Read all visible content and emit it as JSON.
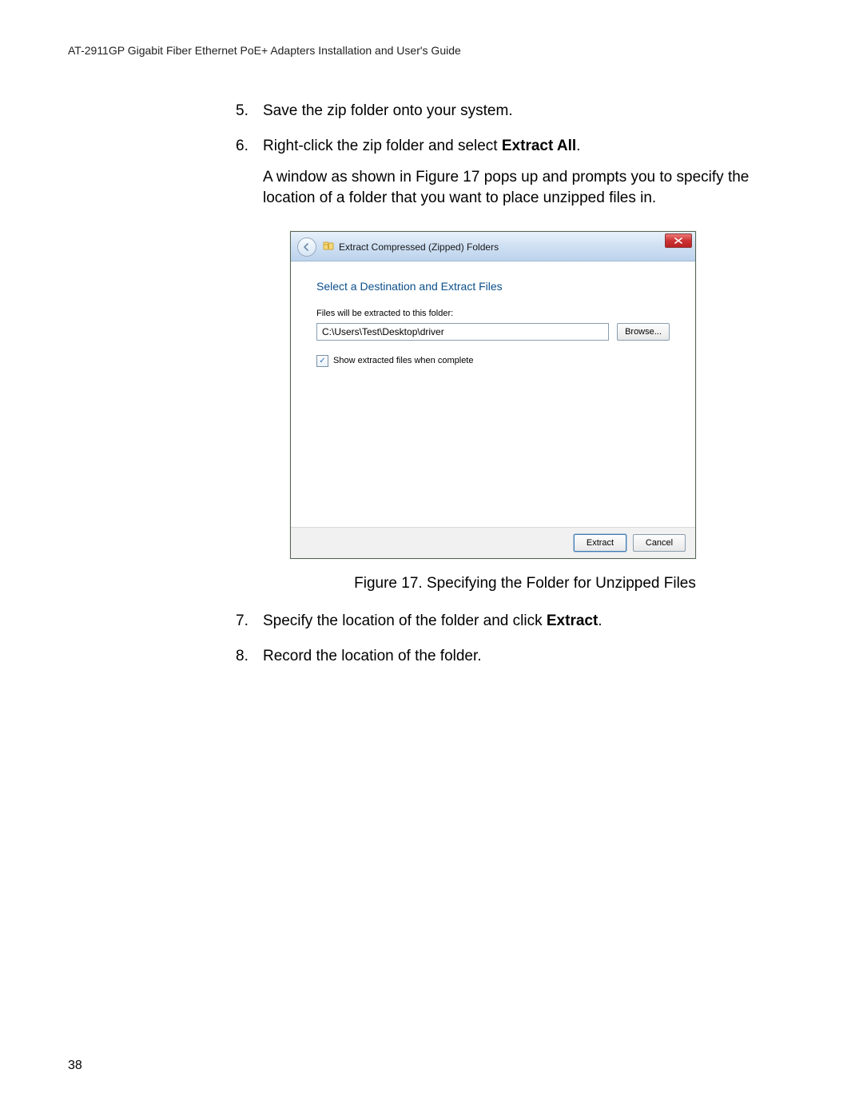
{
  "header": "AT-2911GP Gigabit Fiber Ethernet PoE+ Adapters Installation and User's Guide",
  "page_number": "38",
  "steps": {
    "s5": {
      "num": "5.",
      "text": "Save the zip folder onto your system."
    },
    "s6": {
      "num": "6.",
      "text_pre": "Right-click the zip folder and select ",
      "text_bold": "Extract All",
      "text_post": ".",
      "para": "A window as shown in Figure 17 pops up and prompts you to specify the location of a folder that you want to place unzipped files in."
    },
    "s7": {
      "num": "7.",
      "text_pre": "Specify the location of the folder and click ",
      "text_bold": "Extract",
      "text_post": "."
    },
    "s8": {
      "num": "8.",
      "text": "Record the location of the folder."
    }
  },
  "figure_caption": "Figure 17. Specifying the Folder for Unzipped Files",
  "dialog": {
    "title": "Extract Compressed (Zipped) Folders",
    "heading": "Select a Destination and Extract Files",
    "field_label": "Files will be extracted to this folder:",
    "path_value": "C:\\Users\\Test\\Desktop\\driver",
    "browse": "Browse...",
    "checkbox_label": "Show extracted files when complete",
    "checkbox_checked": "✓",
    "extract": "Extract",
    "cancel": "Cancel"
  }
}
